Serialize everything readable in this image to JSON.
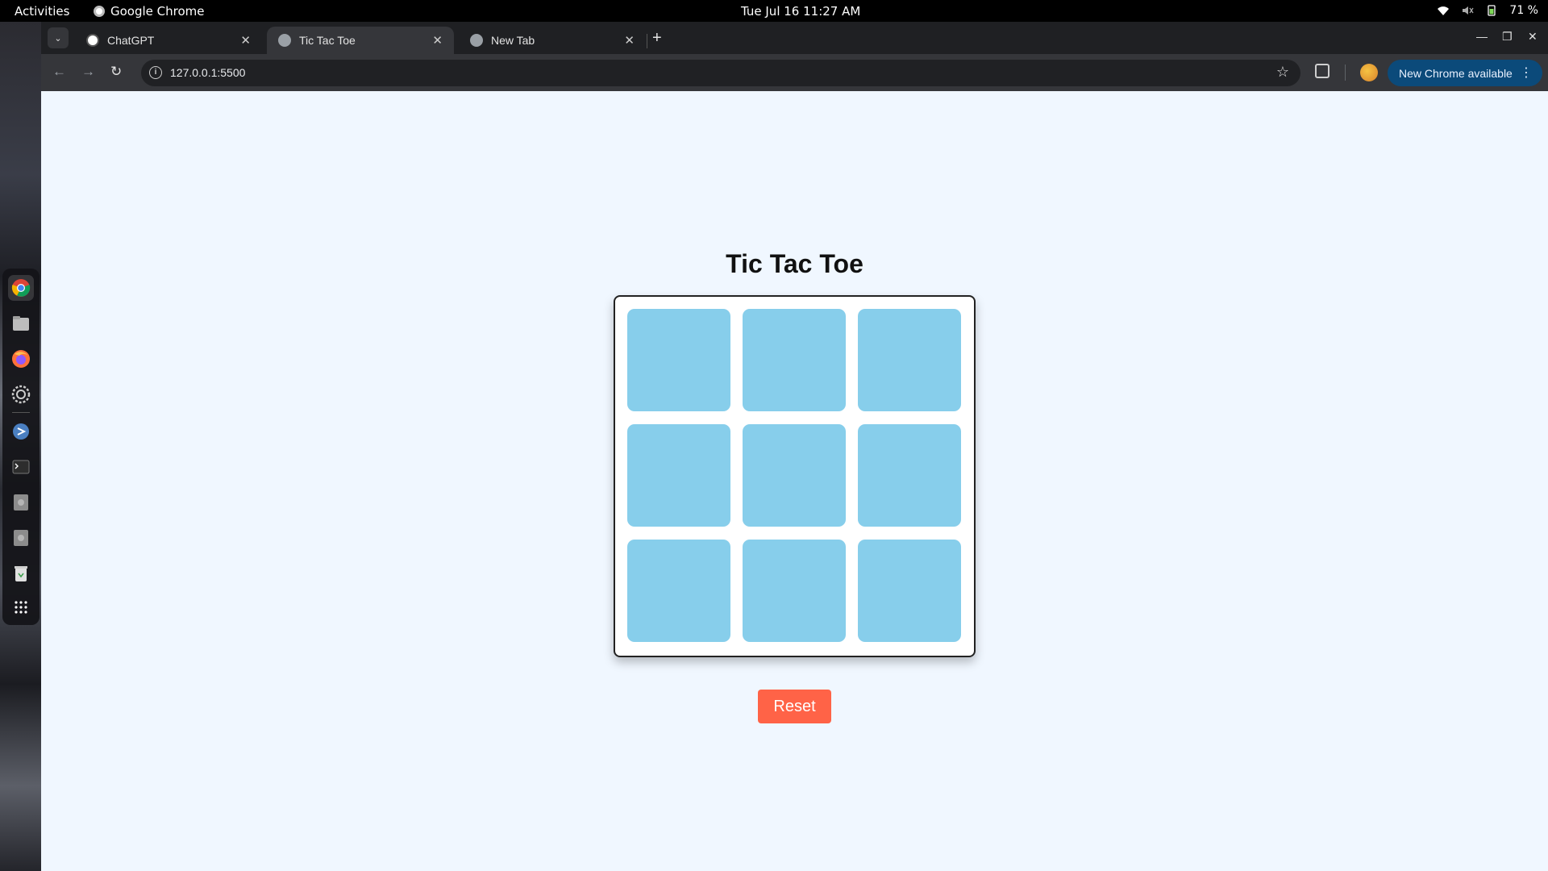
{
  "system_bar": {
    "activities": "Activities",
    "app_name": "Google Chrome",
    "clock": "Tue Jul 16  11:27 AM",
    "battery": "71 %"
  },
  "dock": {
    "items": [
      "chrome-icon",
      "files-icon",
      "firefox-icon",
      "settings-icon",
      "vscode-icon",
      "terminal-icon",
      "disk-icon",
      "disk-icon",
      "trash-icon",
      "apps-grid-icon"
    ]
  },
  "browser": {
    "tabs": [
      {
        "label": "ChatGPT",
        "active": false
      },
      {
        "label": "Tic Tac Toe",
        "active": true
      },
      {
        "label": "New Tab",
        "active": false
      }
    ],
    "url": "127.0.0.1:5500",
    "update_label": "New Chrome available"
  },
  "game": {
    "title": "Tic Tac Toe",
    "cells": [
      "",
      "",
      "",
      "",
      "",
      "",
      "",
      "",
      ""
    ],
    "reset_label": "Reset"
  },
  "colors": {
    "cell": "#87ceeb",
    "reset": "#ff6347",
    "page_bg": "#f0f7ff"
  }
}
